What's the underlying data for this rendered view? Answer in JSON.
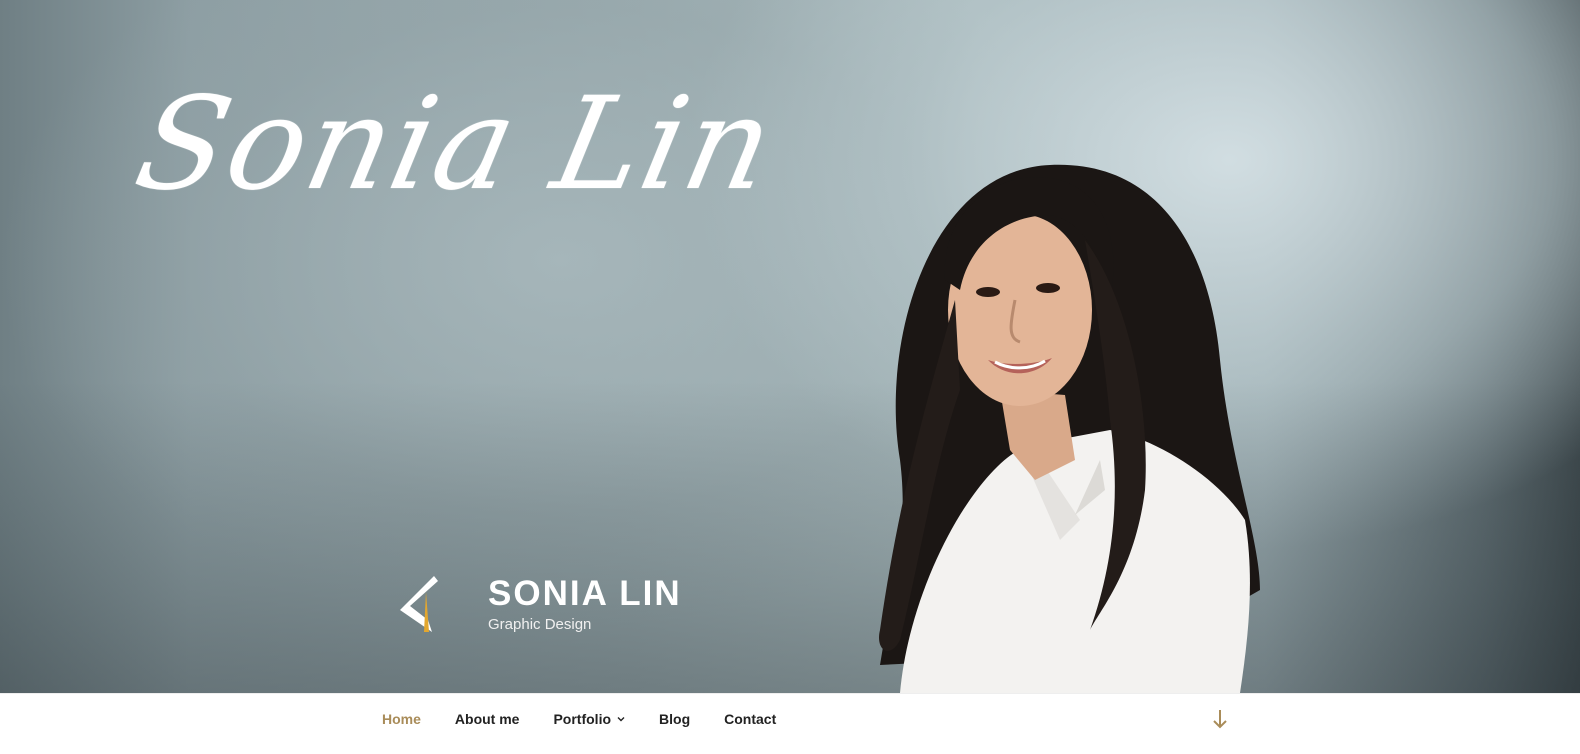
{
  "hero": {
    "signature_text": "Sonia Lin",
    "portrait": "portrait-photo-woman"
  },
  "brand": {
    "logo_icon": "stylized-triangle-logo-icon",
    "title": "SONIA LIN",
    "tagline": "Graphic Design"
  },
  "nav": {
    "items": [
      {
        "label": "Home",
        "active": true
      },
      {
        "label": "About me",
        "active": false
      },
      {
        "label": "Portfolio",
        "active": false,
        "has_dropdown": true
      },
      {
        "label": "Blog",
        "active": false
      },
      {
        "label": "Contact",
        "active": false
      }
    ],
    "scroll_icon": "arrow-down-icon"
  },
  "colors": {
    "accent": "#a98c59",
    "nav_text": "#222222",
    "logo_gold": "#e3a72f"
  }
}
